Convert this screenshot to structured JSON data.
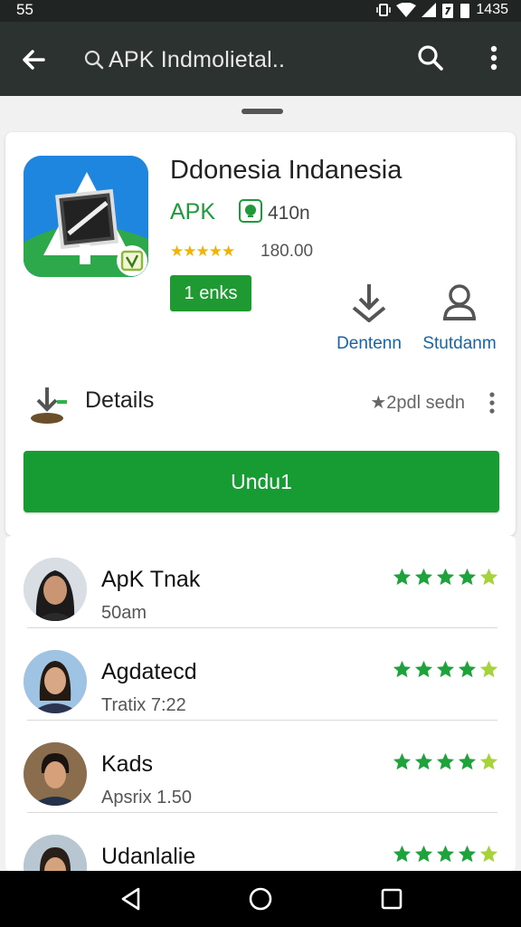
{
  "status_bar": {
    "time_left": "55",
    "battery_text": "1435"
  },
  "app_bar": {
    "search_text": "APK Indmolietal.."
  },
  "app": {
    "title": "Ddonesia Indanesia",
    "developer": "APK",
    "downloads": "410n",
    "stars": "★★★★★",
    "rating_count": "180.00",
    "links_label": "1 enks",
    "actions": [
      {
        "label": "Dentenn",
        "icon": "download-icon"
      },
      {
        "label": "Stutdanm",
        "icon": "user-icon"
      }
    ],
    "details_label": "Details",
    "details_meta": "★2pdl sedn",
    "install_label": "Undu1"
  },
  "reviews": [
    {
      "name": "ApK Tnak",
      "sub": "50am",
      "rating": 4.5
    },
    {
      "name": "Agdatecd",
      "sub": "Tratix 7:22",
      "rating": 4.5
    },
    {
      "name": "Kads",
      "sub": "Apsrix 1.50",
      "rating": 4.5
    },
    {
      "name": "Udanlalie",
      "sub": "",
      "rating": 4.5
    }
  ],
  "colors": {
    "app_bar": "#2c322f",
    "accent_green": "#179c33",
    "link_blue": "#1565a8",
    "star_yellow": "#f2b400"
  }
}
